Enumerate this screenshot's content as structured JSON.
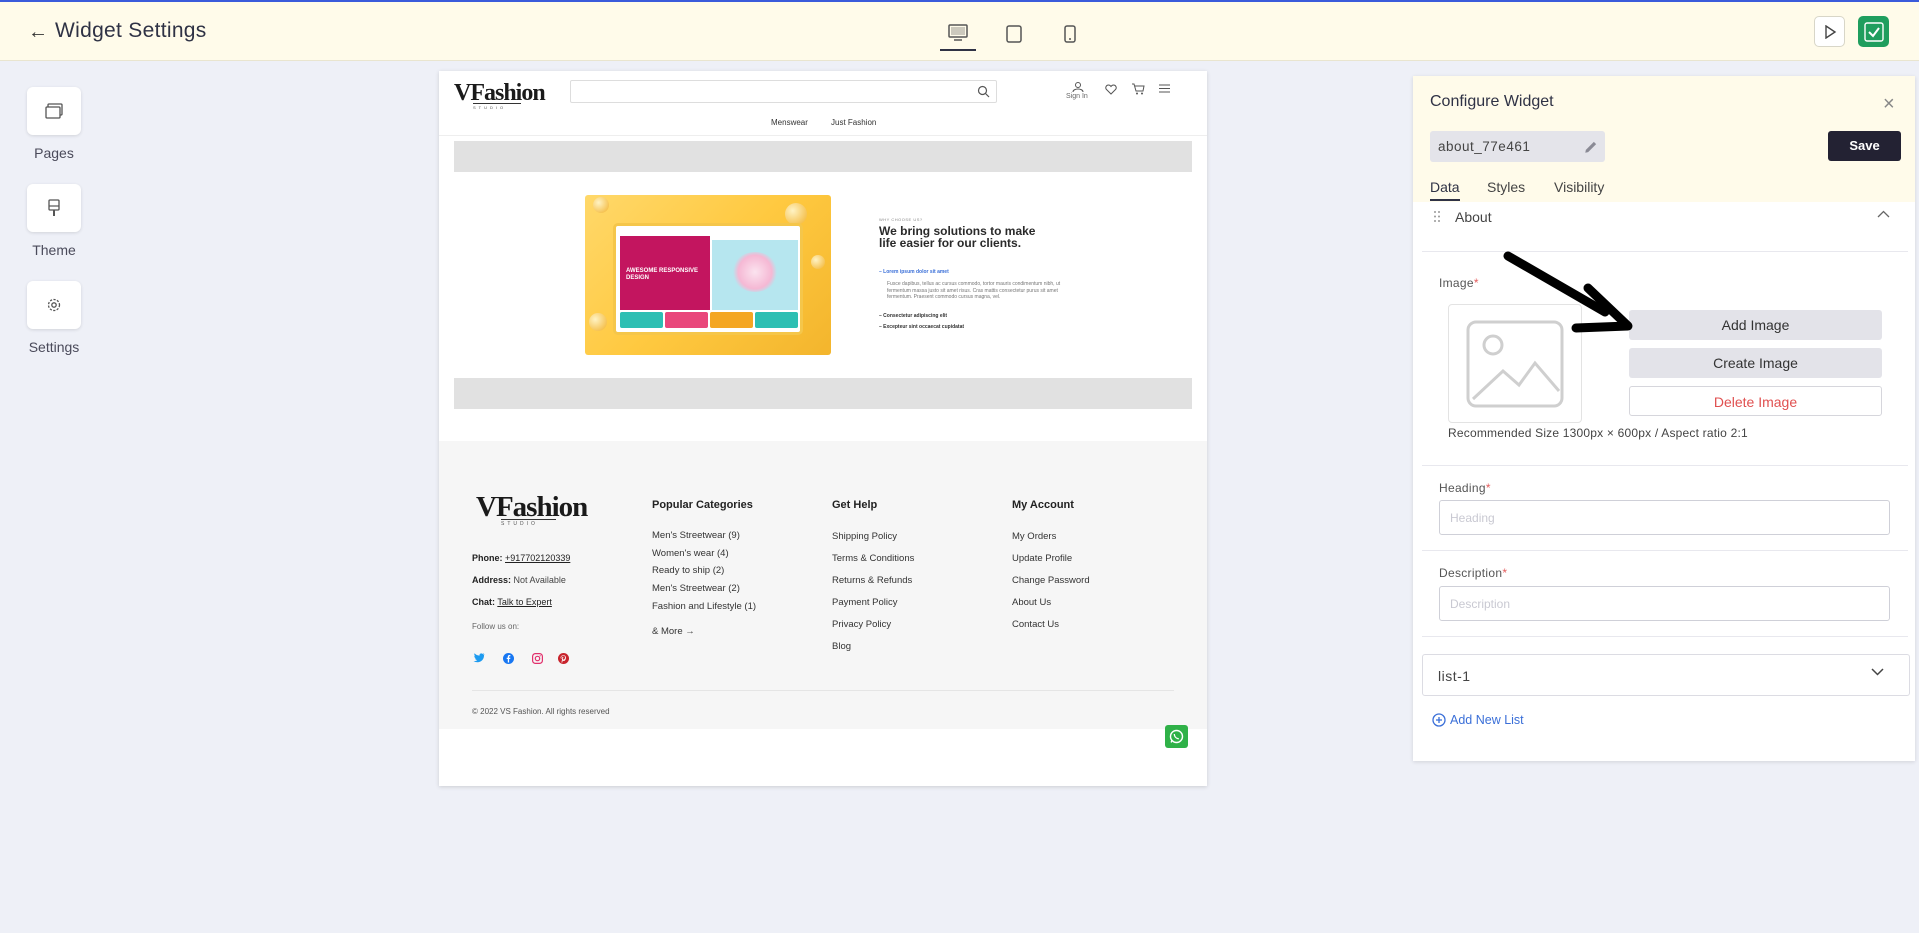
{
  "header": {
    "title": "Widget Settings"
  },
  "rail": {
    "items": [
      {
        "label": "Pages",
        "icon": "pages-icon"
      },
      {
        "label": "Theme",
        "icon": "theme-icon"
      },
      {
        "label": "Settings",
        "icon": "gear-icon"
      }
    ]
  },
  "preview": {
    "nav": {
      "signin": "Sign In",
      "menu": [
        "Menswear",
        "Just Fashion"
      ]
    },
    "logo": "VFashion",
    "logo_sub": "STUDIO",
    "about": {
      "label": "WHY CHOOSE US?",
      "heading": "We bring solutions to make life easier for our clients.",
      "list": [
        "Lorem ipsum dolor sit amet",
        "Consectetur adipiscing elit",
        "Excepteur sint occaecat cupidatat"
      ],
      "body": "Fusce dapibus, tellus ac cursus commodo, tortor mauris condimentum nibh, ut fermentum massa justo sit amet risus. Cras mattis consectetur purus sit amet fermentum. Praesent commodo cursus magna, vel.",
      "hero_text": "AWESOME RESPONSIVE DESIGN"
    },
    "footer": {
      "phone_label": "Phone:",
      "phone": "+917702120339",
      "address_label": "Address:",
      "address": "Not Available",
      "chat_label": "Chat:",
      "chat": "Talk to Expert",
      "follow": "Follow us on:",
      "columns": [
        {
          "title": "Popular Categories",
          "items": [
            "Men's Streetwear (9)",
            "Women's wear (4)",
            "Ready to ship (2)",
            "Men's Streetwear (2)",
            "Fashion and Lifestyle (1)",
            "& More →"
          ]
        },
        {
          "title": "Get Help",
          "items": [
            "Shipping Policy",
            "Terms & Conditions",
            "Returns & Refunds",
            "Payment Policy",
            "Privacy Policy",
            "Blog"
          ]
        },
        {
          "title": "My Account",
          "items": [
            "My Orders",
            "Update Profile",
            "Change Password",
            "About Us",
            "Contact Us"
          ]
        }
      ],
      "copyright": "© 2022 VS Fashion. All rights reserved"
    }
  },
  "panel": {
    "title": "Configure Widget",
    "widget_name": "about_77e461",
    "save_label": "Save",
    "tabs": [
      "Data",
      "Styles",
      "Visibility"
    ],
    "active_tab": "Data",
    "section_title": "About",
    "image": {
      "label": "Image",
      "required_mark": "*",
      "add_label": "Add Image",
      "create_label": "Create Image",
      "delete_label": "Delete Image",
      "hint": "Recommended Size 1300px × 600px / Aspect ratio 2:1"
    },
    "heading": {
      "label": "Heading",
      "required_mark": "*",
      "placeholder": "Heading"
    },
    "description": {
      "label": "Description",
      "required_mark": "*",
      "placeholder": "Description"
    },
    "list_label": "list-1",
    "add_list_label": "Add New List"
  },
  "colors": {
    "topbar_bg": "#fffbea",
    "accent_dark": "#232233",
    "link_blue": "#3a6fd8",
    "danger": "#e05050",
    "success": "#1f9e5e"
  }
}
